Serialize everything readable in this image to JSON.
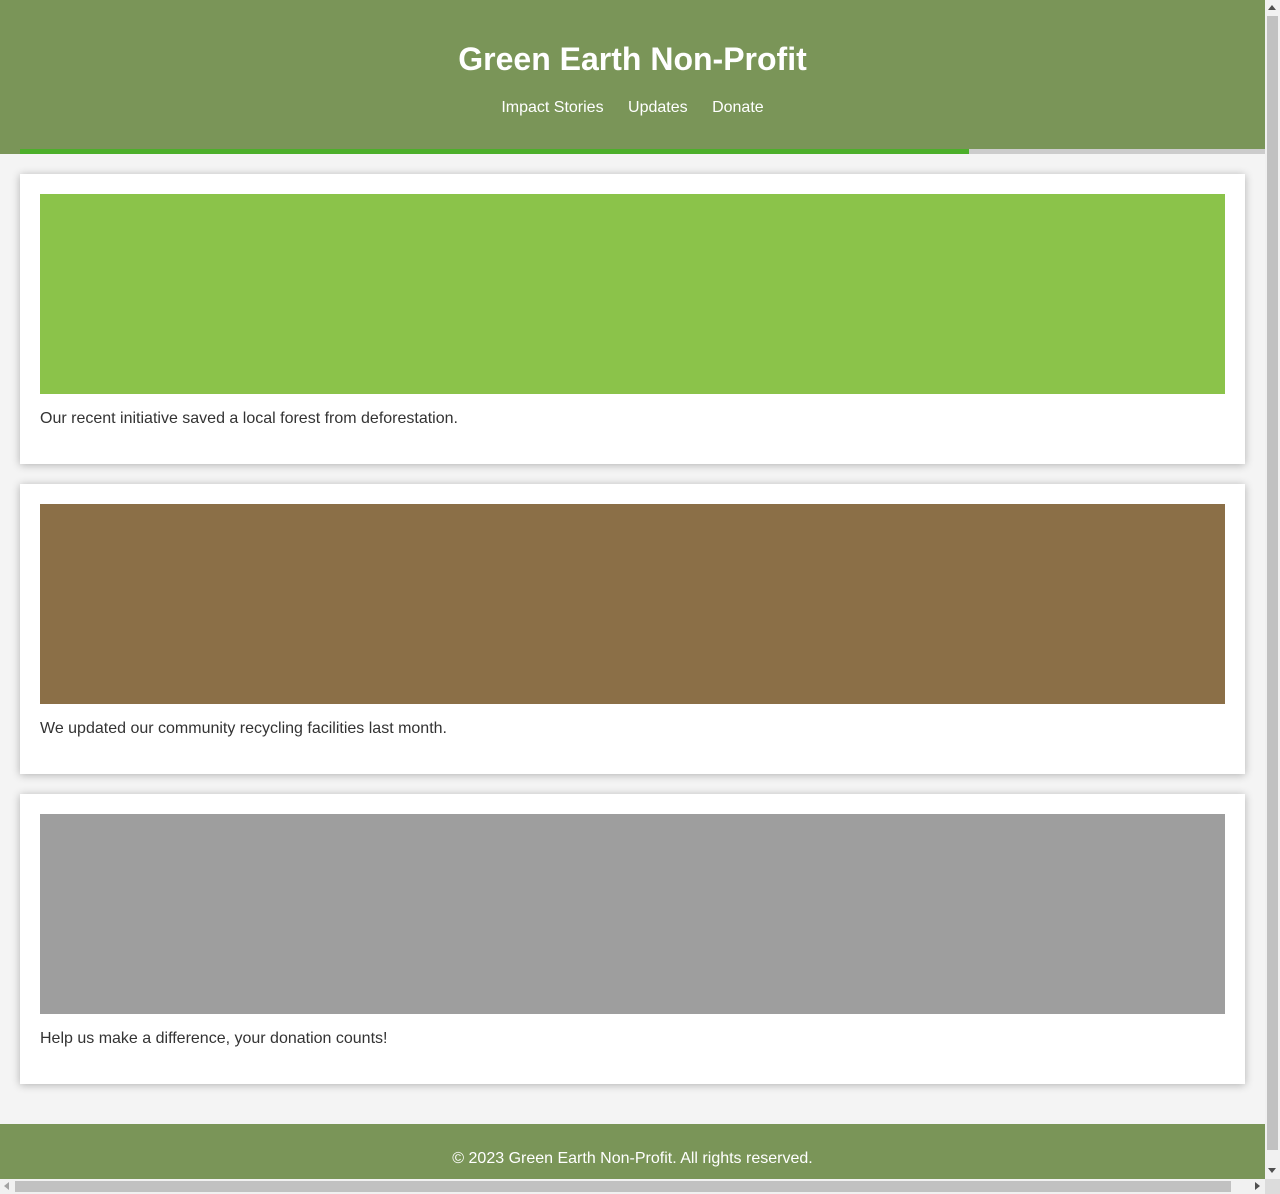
{
  "header": {
    "title": "Green Earth Non-Profit",
    "nav": [
      "Impact Stories",
      "Updates",
      "Donate"
    ],
    "background_color": "#7a9558",
    "progress": {
      "fraction": 0.762,
      "fill_color": "#4caf2a",
      "track_color": "#cccccc"
    }
  },
  "cards": [
    {
      "image_color": "#8bc34a",
      "text": "Our recent initiative saved a local forest from deforestation."
    },
    {
      "image_color": "#8b6f47",
      "text": "We updated our community recycling facilities last month."
    },
    {
      "image_color": "#9e9e9e",
      "text": "Help us make a difference, your donation counts!"
    }
  ],
  "footer": {
    "text": "© 2023 Green Earth Non-Profit. All rights reserved."
  }
}
